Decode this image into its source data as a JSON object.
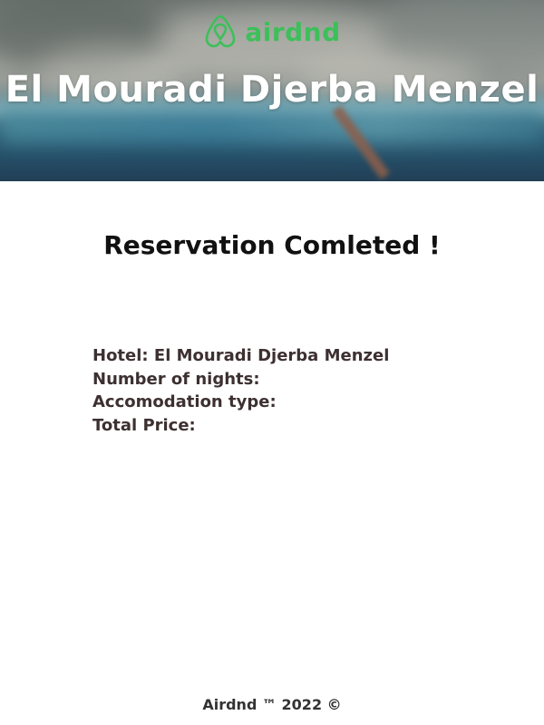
{
  "brand": {
    "name": "airdnd",
    "color": "#3dbf5a",
    "logo_icon": "airbnb-style-loop-icon"
  },
  "hero": {
    "title": "El Mouradi Djerba Menzel"
  },
  "main": {
    "heading": "Reservation Comleted !",
    "details": [
      {
        "label": "Hotel:",
        "value": "El Mouradi Djerba Menzel"
      },
      {
        "label": "Number of nights:",
        "value": ""
      },
      {
        "label": "Accomodation type:",
        "value": ""
      },
      {
        "label": "Total Price:",
        "value": ""
      }
    ]
  },
  "footer": {
    "text": "Airdnd ™ 2022 ©"
  }
}
